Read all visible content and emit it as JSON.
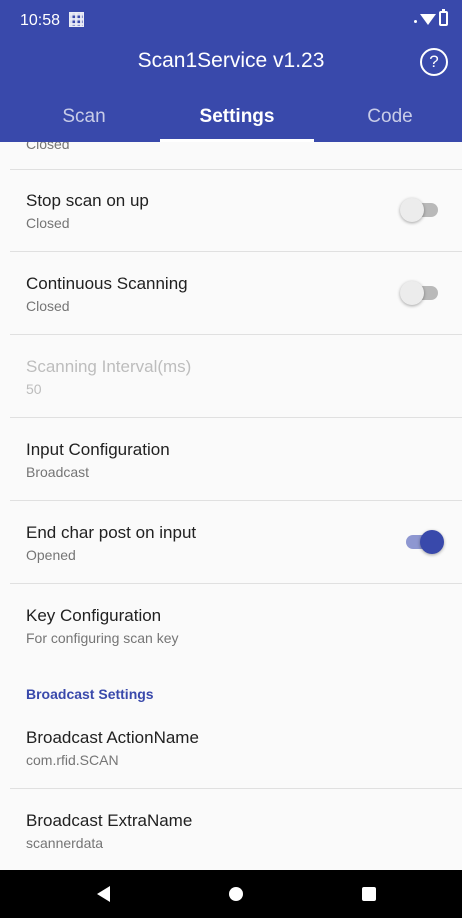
{
  "status_bar": {
    "time": "10:58"
  },
  "app_bar": {
    "title": "Scan1Service v1.23",
    "help_symbol": "?",
    "accent_color": "#3949ab"
  },
  "tabs": [
    {
      "label": "Scan",
      "selected": false
    },
    {
      "label": "Settings",
      "selected": true
    },
    {
      "label": "Code",
      "selected": false
    }
  ],
  "settings": {
    "cut_off_summary": "Closed",
    "items": [
      {
        "label": "Stop scan on up",
        "summary": "Closed",
        "switch": "off",
        "enabled": true
      },
      {
        "label": "Continuous Scanning",
        "summary": "Closed",
        "switch": "off",
        "enabled": true
      },
      {
        "label": "Scanning Interval(ms)",
        "summary": "50",
        "enabled": false
      },
      {
        "label": "Input Configuration",
        "summary": "Broadcast",
        "enabled": true
      },
      {
        "label": "End char post on input",
        "summary": "Opened",
        "switch": "on",
        "enabled": true
      },
      {
        "label": "Key Configuration",
        "summary": "For configuring scan key",
        "enabled": true
      }
    ],
    "category": "Broadcast Settings",
    "broadcast_items": [
      {
        "label": "Broadcast ActionName",
        "summary": "com.rfid.SCAN"
      },
      {
        "label": "Broadcast ExtraName",
        "summary": "scannerdata"
      }
    ]
  },
  "icons": {
    "status": [
      "qr-notification-icon",
      "wifi-icon",
      "battery-icon"
    ],
    "help": "help-icon",
    "nav": [
      "back-icon",
      "home-icon",
      "recents-icon"
    ]
  }
}
